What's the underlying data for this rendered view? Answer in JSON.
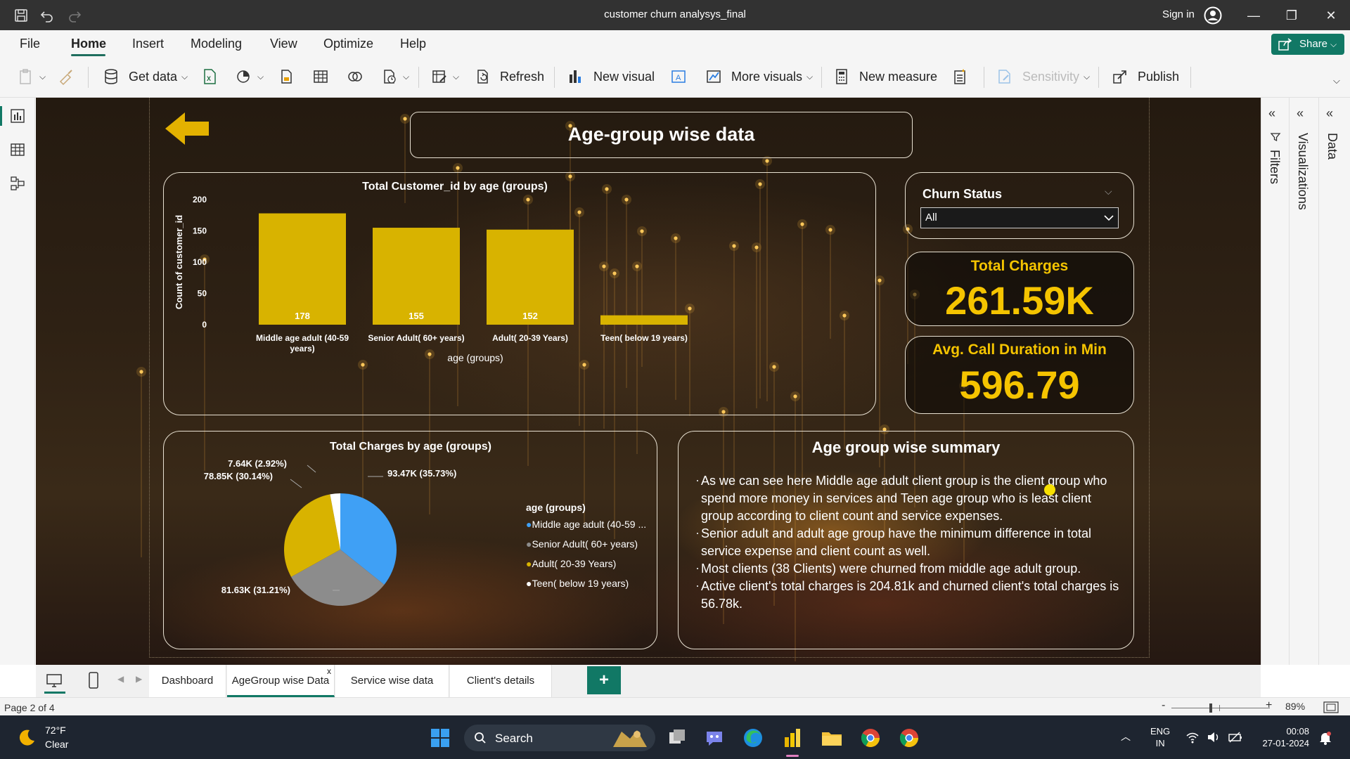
{
  "app": {
    "window_title": "customer churn analysys_final",
    "sign_in": "Sign in"
  },
  "menu": {
    "items": [
      "File",
      "Home",
      "Insert",
      "Modeling",
      "View",
      "Optimize",
      "Help"
    ],
    "active": "Home",
    "share_label": "Share"
  },
  "ribbon": {
    "get_data": "Get data",
    "refresh": "Refresh",
    "new_visual": "New visual",
    "more_visuals": "More visuals",
    "new_measure": "New measure",
    "sensitivity": "Sensitivity",
    "publish": "Publish"
  },
  "report": {
    "page_title": "Age-group wise data",
    "bar_chart_title": "Total Customer_id by age (groups)",
    "pie_chart_title": "Total Charges by age (groups)",
    "churn_filter": {
      "title": "Churn Status",
      "selected": "All"
    },
    "kpis": {
      "total_charges_label": "Total Charges",
      "total_charges_value": "261.59K",
      "avg_call_label": "Avg. Call Duration in Min",
      "avg_call_value": "596.79"
    },
    "summary": {
      "title": "Age group wise summary",
      "lines": [
        "As we can see here Middle age adult client group is the client group who spend more money in services and Teen age group who is least client group according to client count and service expenses.",
        "Senior adult and adult age group have the minimum difference in total service expense and client count as well.",
        "Most clients (38 Clients)  were churned from middle age adult group.",
        "Active client's total charges is 204.81k and churned client's total charges is 56.78k."
      ]
    },
    "pie_legend": {
      "title": "age (groups)",
      "items": [
        {
          "label": "Middle age adult (40-59 ...",
          "color": "#3fa0f5"
        },
        {
          "label": "Senior Adult( 60+ years)",
          "color": "#8c8c8c"
        },
        {
          "label": "Adult( 20-39 Years)",
          "color": "#d8b300"
        },
        {
          "label": "Teen( below 19 years)",
          "color": "#ffffff"
        }
      ]
    }
  },
  "chart_data": [
    {
      "type": "bar",
      "title": "Total Customer_id by age (groups)",
      "xlabel": "age (groups)",
      "ylabel": "Count of customer_id",
      "categories": [
        "Middle age adult (40-59 years)",
        "Senior Adult( 60+ years)",
        "Adult( 20-39 Years)",
        "Teen( below 19 years)"
      ],
      "values": [
        178,
        155,
        152,
        15
      ],
      "data_labels": [
        "178",
        "155",
        "152",
        ""
      ],
      "yticks": [
        "0",
        "50",
        "100",
        "150",
        "200"
      ],
      "ylim": [
        0,
        200
      ],
      "color": "#d8b300",
      "grid": false
    },
    {
      "type": "pie",
      "title": "Total Charges by age (groups)",
      "categories": [
        "Middle age adult (40-59 years)",
        "Senior Adult( 60+ years)",
        "Adult( 20-39 Years)",
        "Teen( below 19 years)"
      ],
      "values": [
        93.47,
        81.63,
        78.85,
        7.64
      ],
      "labels": [
        "93.47K (35.73%)",
        "81.63K (31.21%)",
        "78.85K (30.14%)",
        "7.64K (2.92%)"
      ],
      "colors": [
        "#3fa0f5",
        "#8c8c8c",
        "#d8b300",
        "#ffffff"
      ],
      "legend": "right"
    }
  ],
  "pages": {
    "tabs": [
      "Dashboard",
      "AgeGroup wise Data",
      "Service wise data",
      "Client's details"
    ],
    "active": "AgeGroup wise Data",
    "indicator": "Page 2 of 4",
    "zoom": "89%"
  },
  "panes": {
    "filters": "Filters",
    "visualizations": "Visualizations",
    "data": "Data"
  },
  "taskbar": {
    "temperature": "72°F",
    "condition": "Clear",
    "search": "Search",
    "lang_top": "ENG",
    "lang_bottom": "IN",
    "time": "00:08",
    "date": "27-01-2024"
  }
}
